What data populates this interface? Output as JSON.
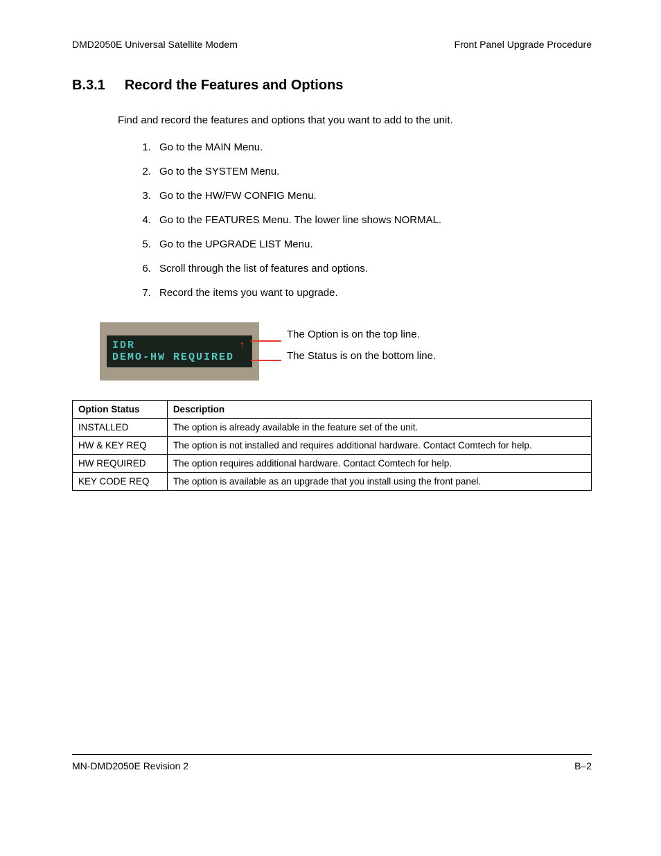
{
  "header": {
    "left": "DMD2050E Universal Satellite Modem",
    "right": "Front Panel Upgrade Procedure"
  },
  "section": {
    "number": "B.3.1",
    "title": "Record the Features and Options"
  },
  "intro": "Find and record the features and options that you want to add to the unit.",
  "steps": [
    "Go to the MAIN Menu.",
    "Go to the SYSTEM Menu.",
    "Go to the HW/FW CONFIG Menu.",
    "Go to the FEATURES Menu.  The lower line shows NORMAL.",
    "Go to the UPGRADE LIST Menu.",
    "Scroll through the list of features and options.",
    "Record the items you want to upgrade."
  ],
  "display": {
    "line1": "IDR",
    "arrow": "↑",
    "line2": "DEMO-HW REQUIRED"
  },
  "legend": {
    "top": "The Option is on the top line.",
    "bottom": "The Status is on the bottom line."
  },
  "table": {
    "headers": [
      "Option Status",
      "Description"
    ],
    "rows": [
      [
        "INSTALLED",
        "The option is already available in the feature set of the unit."
      ],
      [
        "HW & KEY REQ",
        "The option is not installed and requires additional hardware.  Contact Comtech for help."
      ],
      [
        "HW REQUIRED",
        "The option requires additional hardware.  Contact Comtech for help."
      ],
      [
        "KEY CODE REQ",
        "The option is available as an upgrade that you install using the front panel."
      ]
    ]
  },
  "footer": {
    "left": "MN-DMD2050E   Revision 2",
    "right": "B–2"
  }
}
